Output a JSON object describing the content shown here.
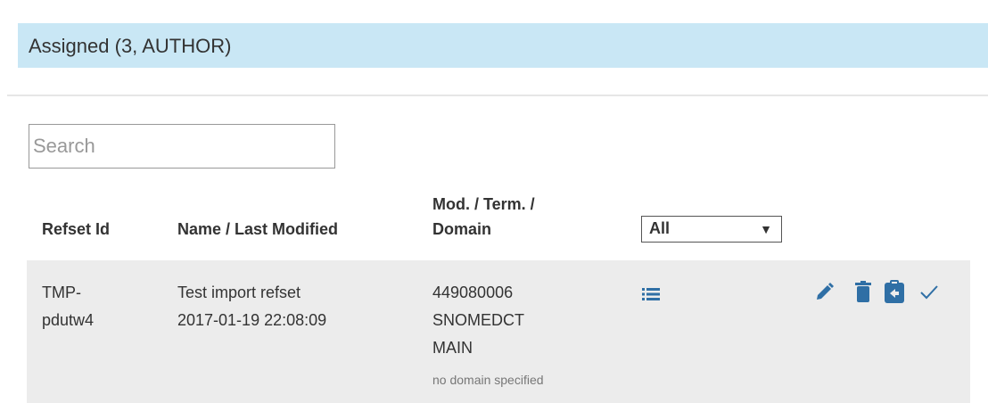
{
  "panel": {
    "title": "Assigned (3, AUTHOR)"
  },
  "search": {
    "placeholder": "Search",
    "value": ""
  },
  "table": {
    "columns": {
      "refset_id": "Refset Id",
      "name_modified": "Name / Last Modified",
      "mod_term_line1": "Mod. / Term. /",
      "mod_term_line2": "Domain"
    },
    "filter": {
      "selected": "All",
      "arrow": "▼"
    },
    "rows": [
      {
        "refset_id_line1": "TMP-",
        "refset_id_line2": "pdutw4",
        "name": "Test import refset",
        "last_modified": "2017-01-19 22:08:09",
        "module": "449080006",
        "terminology": "SNOMEDCT",
        "version": "MAIN",
        "domain": "no domain specified"
      }
    ]
  },
  "icons": {
    "members": "list-icon",
    "edit": "pencil-icon",
    "delete": "trash-icon",
    "clipboard": "clipboard-icon",
    "finish": "check-icon"
  },
  "colors": {
    "header_bg": "#c9e7f5",
    "row_bg": "#ececec",
    "icon": "#2f6fa5"
  }
}
